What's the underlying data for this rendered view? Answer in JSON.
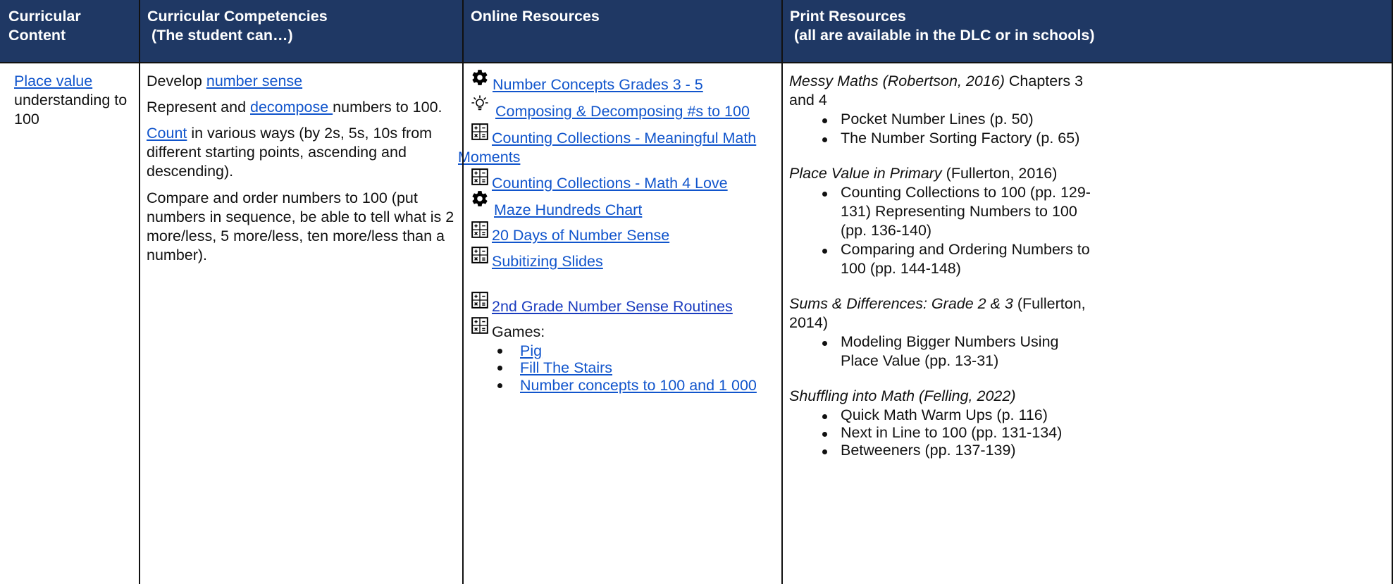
{
  "header": {
    "col1": [
      "Curricular",
      "Content"
    ],
    "col2": [
      "Curricular Competencies",
      " (The student can…)"
    ],
    "col3": [
      "Online Resources"
    ],
    "col4": [
      "Print Resources",
      " (all are available in the DLC or in schools)"
    ]
  },
  "content": {
    "link": "Place value",
    "lines": [
      "understanding to",
      "100"
    ]
  },
  "competencies": {
    "p1_text": "Develop ",
    "p1_link": "number sense",
    "p2_text_a": "Represent and ",
    "p2_link": "decompose ",
    "p2_text_b": "numbers to 100.",
    "p3_link": "Count",
    "p3_lines": [
      " in various ways (by 2s, 5s, 10s from",
      "different starting points, ascending and",
      "descending)."
    ],
    "p4_lines": [
      "Compare and order numbers to 100 (put",
      "numbers in sequence, be able to tell what is 2",
      "more/less, 5 more/less, ten more/less than a",
      "number)."
    ]
  },
  "online": {
    "r1": "Number Concepts Grades 3 - 5",
    "r2": "Composing & Decomposing #s to 100",
    "r3a": "Counting Collections - Meaningful Math",
    "r3b": "Moments",
    "r4": "Counting Collections - Math 4 Love",
    "r5": "Maze Hundreds Chart",
    "r6": "20 Days of Number Sense",
    "r7": "Subitizing Slides",
    "r8": "2nd Grade Number Sense Routines",
    "games_label": "Games:",
    "games": [
      "Pig",
      "Fill The Stairs",
      "Number concepts to 100 and 1 000"
    ],
    "icons": {
      "gear": "gear-icon",
      "bulb": "lightbulb-icon",
      "calc": "calculator-icon"
    }
  },
  "print": {
    "b1_title": "Messy Maths (Robertson, 2016)",
    "b1_rest": " Chapters 3",
    "b1_line2": "and 4",
    "b1_items": [
      "Pocket Number Lines (p. 50)",
      "The Number Sorting Factory (p. 65)"
    ],
    "b2_title": "Place Value in Primary",
    "b2_rest": " (Fullerton, 2016)",
    "b2_item1": [
      "Counting Collections to 100 (pp. 129-",
      "131) Representing Numbers to 100",
      "(pp. 136-140)"
    ],
    "b2_item2": [
      "Comparing and Ordering Numbers to",
      "100 (pp. 144-148)"
    ],
    "b3_title": "Sums & Differences: Grade 2 & 3",
    "b3_rest": " (Fullerton,",
    "b3_line2": "2014)",
    "b3_item1": [
      "Modeling Bigger Numbers Using",
      "Place Value (pp. 13-31)"
    ],
    "b4_title": "Shuffling into Math (Felling, 2022)",
    "b4_items": [
      "Quick Math Warm Ups (p. 116)",
      "Next in Line to 100 (pp. 131-134)",
      "Betweeners (pp. 137-139)"
    ]
  },
  "colors": {
    "header_bg": "#1f3864",
    "header_text": "#ffffff",
    "link": "#1155cc",
    "rule": "#111111"
  }
}
